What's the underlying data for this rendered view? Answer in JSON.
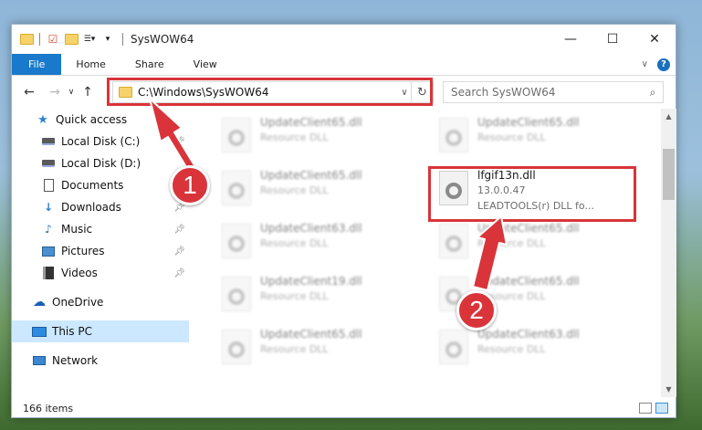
{
  "window": {
    "title": "SysWOW64",
    "minimize_glyph": "—",
    "maximize_glyph": "☐",
    "close_glyph": "✕"
  },
  "ribbon": {
    "tabs": [
      "File",
      "Home",
      "Share",
      "View"
    ]
  },
  "navigation": {
    "address_path": "C:\\Windows\\SysWOW64",
    "search_placeholder": "Search SysWOW64"
  },
  "sidebar": {
    "items": [
      {
        "label": "Quick access",
        "icon": "star-icon"
      },
      {
        "label": "Local Disk (C:)",
        "icon": "drive-icon",
        "pinned": true
      },
      {
        "label": "Local Disk (D:)",
        "icon": "drive-icon"
      },
      {
        "label": "Documents",
        "icon": "documents-icon",
        "pinned": true
      },
      {
        "label": "Downloads",
        "icon": "download-icon",
        "pinned": true
      },
      {
        "label": "Music",
        "icon": "music-icon",
        "pinned": true
      },
      {
        "label": "Pictures",
        "icon": "pictures-icon",
        "pinned": true
      },
      {
        "label": "Videos",
        "icon": "videos-icon",
        "pinned": true
      },
      {
        "label": "OneDrive",
        "icon": "cloud-icon"
      },
      {
        "label": "This PC",
        "icon": "computer-icon",
        "selected": true
      },
      {
        "label": "Network",
        "icon": "network-icon"
      }
    ]
  },
  "files": {
    "left_column": [
      {
        "name": "UpdateClient65.dll",
        "type": "Resource DLL"
      },
      {
        "name": "UpdateClient65.dll",
        "type": "Resource DLL"
      },
      {
        "name": "UpdateClient63.dll",
        "type": "Resource DLL"
      },
      {
        "name": "UpdateClient19.dll",
        "type": "Resource DLL"
      },
      {
        "name": "UpdateClient65.dll",
        "type": "Resource DLL"
      }
    ],
    "right_column": [
      {
        "name": "UpdateClient65.dll",
        "type": "Resource DLL"
      },
      {
        "name": "lfgif13n.dll",
        "version": "13.0.0.47",
        "description": "LEADTOOLS(r) DLL fo...",
        "highlighted": true
      },
      {
        "name": "UpdateClient65.dll",
        "type": "Resource DLL"
      },
      {
        "name": "UpdateClient65.dll",
        "type": "Resource DLL"
      },
      {
        "name": "UpdateClient63.dll",
        "type": "Resource DLL"
      }
    ]
  },
  "status": {
    "item_count": "166 items"
  },
  "annotations": {
    "badge_1": "1",
    "badge_2": "2",
    "color": "#d9343a"
  }
}
